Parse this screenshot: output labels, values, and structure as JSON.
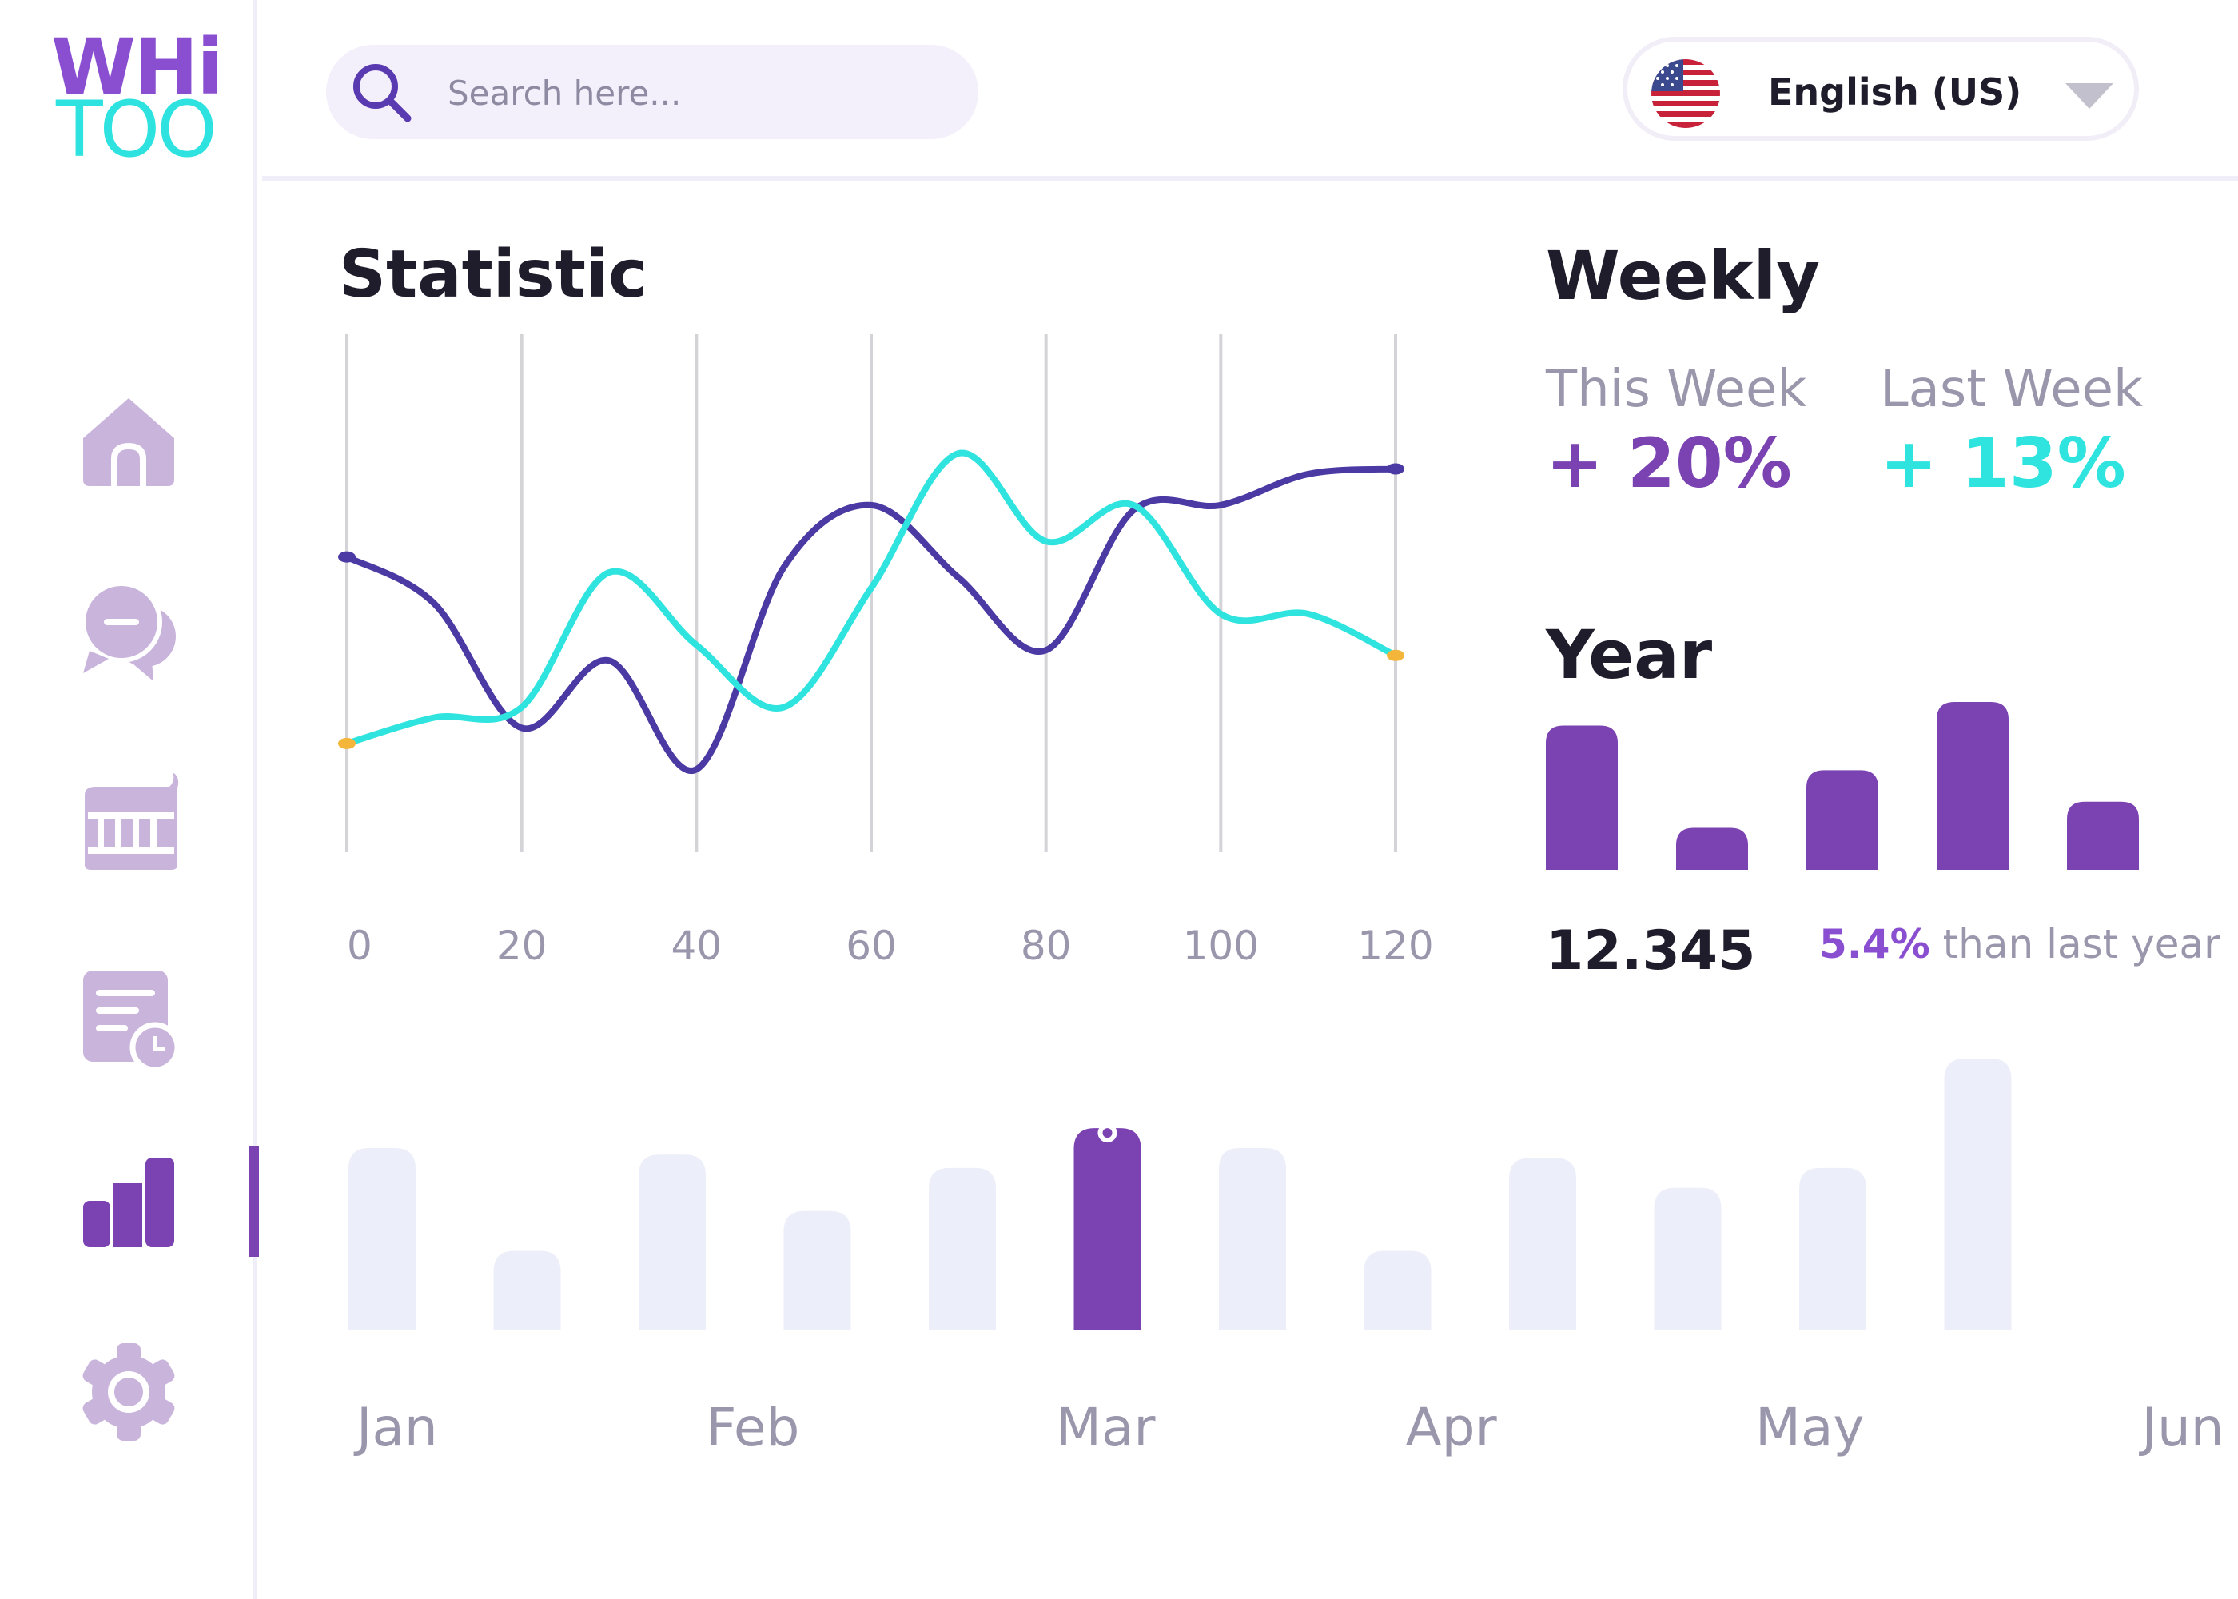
{
  "logo": {
    "line1": "WHi",
    "line2": "TOO"
  },
  "sidebar": {
    "items": [
      {
        "icon": "home-icon",
        "active": false
      },
      {
        "icon": "chat-icon",
        "active": false
      },
      {
        "icon": "teeth-icon",
        "active": false
      },
      {
        "icon": "calendar-schedule-icon",
        "active": false
      },
      {
        "icon": "bar-chart-icon",
        "active": true
      },
      {
        "icon": "gear-icon",
        "active": false
      }
    ]
  },
  "search": {
    "placeholder": "Search here..."
  },
  "language": {
    "label": "English (US)",
    "flag": "us-flag-icon"
  },
  "statistic": {
    "title": "Statistic",
    "chart_data": {
      "type": "line",
      "title": "Statistic",
      "x": [
        0,
        10,
        20,
        30,
        40,
        50,
        60,
        70,
        80,
        90,
        100,
        110,
        120
      ],
      "xticks": [
        "0",
        "20",
        "40",
        "60",
        "80",
        "100",
        "120"
      ],
      "xlim": [
        0,
        120
      ],
      "ylim": [
        0,
        100
      ],
      "grid": "vertical",
      "series": [
        {
          "color": "#4b3aa3",
          "values": [
            57,
            48,
            24,
            37,
            16,
            55,
            67,
            53,
            39,
            66,
            67,
            73,
            74
          ]
        },
        {
          "color": "#2fe3df",
          "values": [
            21,
            26,
            28,
            54,
            40,
            28,
            51,
            77,
            60,
            67,
            46,
            46,
            38
          ]
        }
      ]
    }
  },
  "weekly": {
    "title": "Weekly",
    "this_week_label": "This Week",
    "this_week_value": "+ 20%",
    "last_week_label": "Last Week",
    "last_week_value": "+ 13%"
  },
  "year": {
    "title": "Year",
    "total": "12.345",
    "change_pct": "5.4%",
    "change_text": " than last year",
    "chart_data": {
      "type": "bar",
      "values": [
        55,
        16,
        38,
        64,
        26
      ],
      "color": "#7b42b2"
    }
  },
  "months": {
    "chart_data": {
      "type": "bar",
      "categories": [
        "Jan",
        "Feb",
        "Mar",
        "Apr",
        "May",
        "Jun"
      ],
      "values": [
        55,
        24,
        53,
        36,
        49,
        61,
        55,
        24,
        52,
        43,
        49,
        82
      ],
      "highlight_index": 5,
      "bar_color": "#eceef9",
      "highlight_color": "#7b42b2"
    }
  },
  "colors": {
    "accent": "#7b42b2",
    "teal": "#2fe3df",
    "indigo": "#4b3aa3",
    "muted": "#9a97ad"
  }
}
